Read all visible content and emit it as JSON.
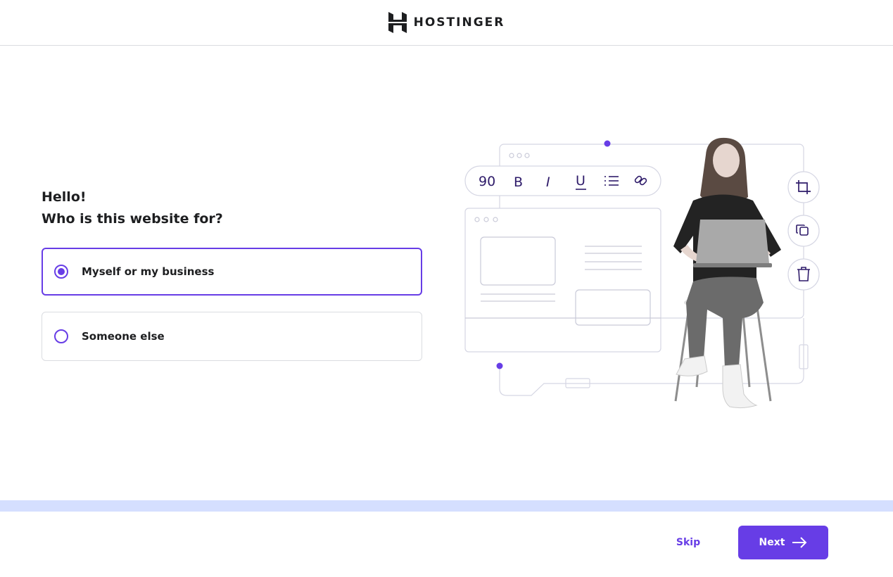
{
  "header": {
    "brand": "HOSTINGER",
    "logo_icon": "hostinger-logo-icon"
  },
  "main": {
    "greeting": "Hello!",
    "question": "Who is this website for?",
    "options": [
      {
        "label": "Myself or my business",
        "selected": true
      },
      {
        "label": "Someone else",
        "selected": false
      }
    ]
  },
  "illustration": {
    "toolbar": {
      "font_size": "90",
      "bold": "B",
      "italic": "I",
      "underline": "U"
    },
    "side_icons": [
      "crop-icon",
      "duplicate-icon",
      "trash-icon"
    ]
  },
  "footer": {
    "skip_label": "Skip",
    "next_label": "Next"
  },
  "colors": {
    "accent": "#673de6",
    "progress_track": "#d5dfff",
    "text": "#1d1e20",
    "border": "#dadce0"
  }
}
